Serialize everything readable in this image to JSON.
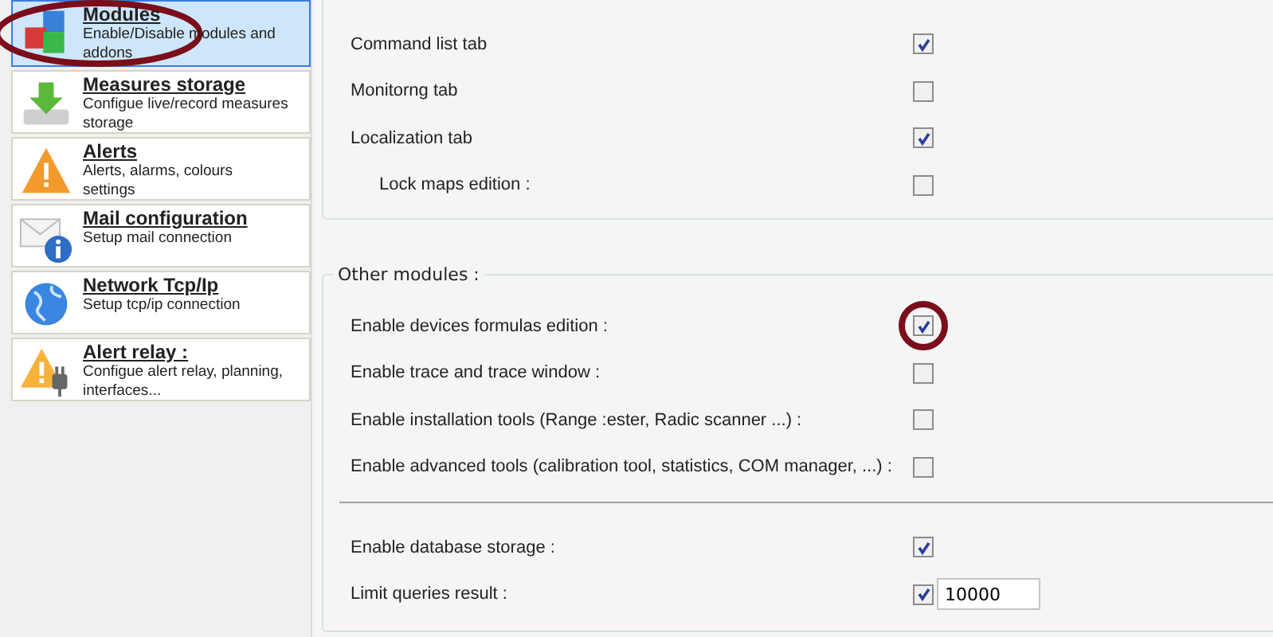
{
  "sidebar": {
    "items": [
      {
        "title": "Modules",
        "description": "Enable/Disable modules and addons",
        "selected": true,
        "circled": true
      },
      {
        "title": "Measures storage",
        "description": "Configue live/record measures storage",
        "selected": false,
        "circled": false
      },
      {
        "title": "Alerts",
        "description": "Alerts, alarms, colours  settings",
        "selected": false,
        "circled": false
      },
      {
        "title": "Mail configuration",
        "description": "Setup mail connection",
        "selected": false,
        "circled": false
      },
      {
        "title": "Network Tcp/Ip",
        "description": "Setup tcp/ip connection",
        "selected": false,
        "circled": false
      },
      {
        "title": "Alert relay :",
        "description": "Configue alert relay, planning, interfaces...",
        "selected": false,
        "circled": false
      }
    ]
  },
  "tabs_group": {
    "options": [
      {
        "label": "Command list tab",
        "checked": true,
        "indented": false
      },
      {
        "label": "Monitorng tab",
        "checked": false,
        "indented": false
      },
      {
        "label": "Localization tab",
        "checked": true,
        "indented": false
      },
      {
        "label": "Lock maps edition :",
        "checked": false,
        "indented": true
      }
    ]
  },
  "other_modules": {
    "title": "Other modules :",
    "options": [
      {
        "label": "Enable devices formulas edition :",
        "checked": true,
        "circled": true,
        "kind": "checkbox"
      },
      {
        "label": "Enable trace and trace window :",
        "checked": false,
        "circled": false,
        "kind": "checkbox"
      },
      {
        "label": "Enable installation tools (Range :ester, Radic scanner ...) :",
        "checked": false,
        "circled": false,
        "kind": "checkbox"
      },
      {
        "label": "Enable advanced tools (calibration tool, statistics, COM manager, ...) :",
        "checked": false,
        "circled": false,
        "kind": "checkbox"
      },
      {
        "kind": "separator"
      },
      {
        "label": "Enable database storage :",
        "checked": true,
        "circled": false,
        "kind": "checkbox"
      },
      {
        "label": "Limit queries result :",
        "checked": true,
        "circled": false,
        "kind": "checkbox-input",
        "value": "10000"
      }
    ]
  }
}
